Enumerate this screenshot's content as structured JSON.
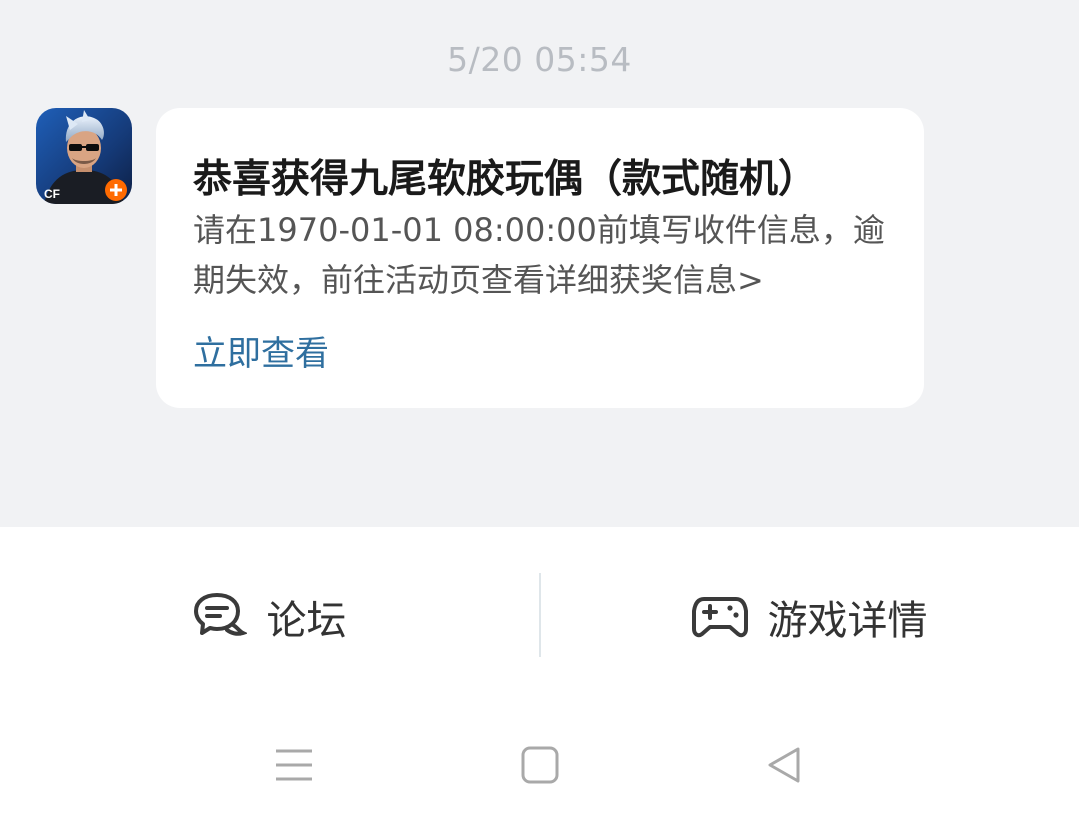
{
  "chat": {
    "timestamp": "5/20  05:54",
    "message": {
      "title": "恭喜获得九尾软胶玩偶（款式随机）",
      "body": "请在1970-01-01 08:00:00前填写收件信息，逾期失效，前往活动页查看详细获奖信息>",
      "link_label": "立即查看"
    }
  },
  "bottom_bar": {
    "forum_label": "论坛",
    "game_details_label": "游戏详情"
  },
  "icons": {
    "forum": "chat-bubble-icon",
    "game": "gamepad-icon",
    "menu": "menu-icon",
    "home": "home-icon",
    "back": "back-icon"
  },
  "colors": {
    "chat_bg": "#f1f2f4",
    "link": "#2f6f9f",
    "nav_icon": "#a9a9a9"
  }
}
